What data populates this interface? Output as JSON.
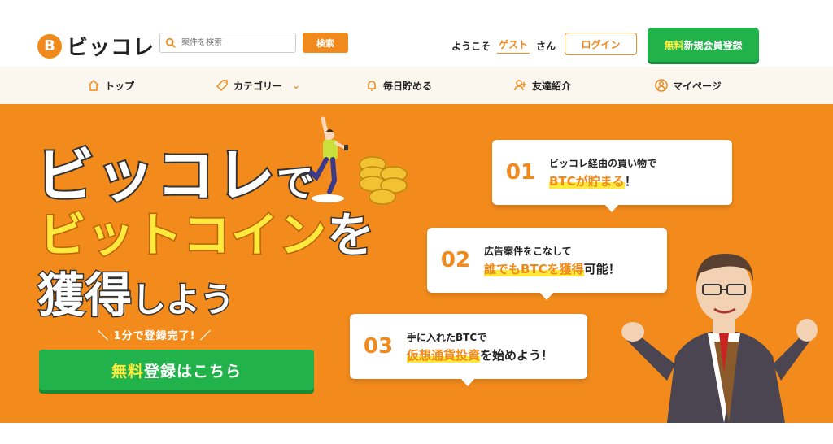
{
  "header": {
    "logo_coin": "B",
    "logo_text": "ビッコレ",
    "search": {
      "placeholder": "案件を検索",
      "button_label": "検索"
    },
    "welcome_prefix": "ようこそ",
    "guest_label": "ゲスト",
    "welcome_suffix": "さん",
    "login_label": "ログイン",
    "signup": {
      "highlight": "無料",
      "label": "新規会員登録"
    }
  },
  "nav": {
    "items": [
      {
        "label": "トップ",
        "icon": "home-icon"
      },
      {
        "label": "カテゴリー",
        "icon": "tag-icon",
        "dropdown": "⌄"
      },
      {
        "label": "毎日貯める",
        "icon": "bell-icon"
      },
      {
        "label": "友達紹介",
        "icon": "add-user-icon"
      },
      {
        "label": "マイページ",
        "icon": "person-circle-icon"
      }
    ]
  },
  "hero": {
    "headline_1_main": "ビッコレ",
    "headline_1_small": "で",
    "headline_2_main": "ビットコイン",
    "headline_2_end": "を",
    "headline_3_main": "獲得",
    "headline_3_small": "しよう",
    "sub_cta": "＼ 1分で登録完了! ／",
    "cta": {
      "highlight": "無料",
      "label": "登録はこちら"
    },
    "bubbles": [
      {
        "num": "01",
        "line1": "ビッコレ経由の買い物で",
        "line2_accent": "BTCが貯まる",
        "line2_end": "！"
      },
      {
        "num": "02",
        "line1": "広告案件をこなして",
        "line2_accent": "誰でもBTCを獲得",
        "line2_end": "可能！"
      },
      {
        "num": "03",
        "line1": "手に入れたBTCで",
        "line2_accent": "仮想通貨投資",
        "line2_end": "を始めよう！"
      }
    ]
  },
  "colors": {
    "accent": "#f28a1c",
    "green": "#22b24c",
    "yellow": "#ffe93c"
  }
}
